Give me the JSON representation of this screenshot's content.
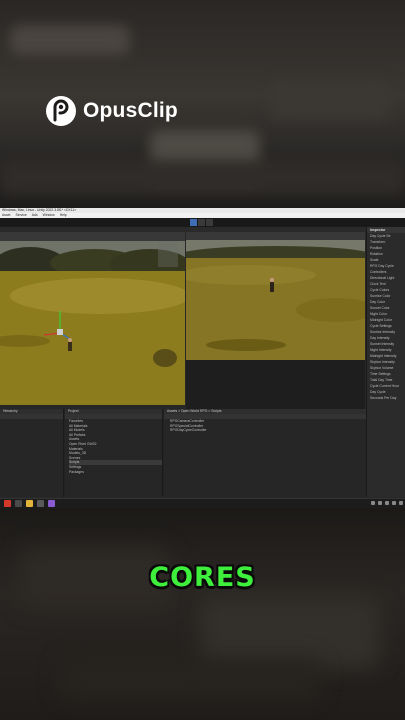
{
  "logo": {
    "text": "OpusClip",
    "icon": "opusclip-logo-icon"
  },
  "caption": {
    "text": "CORES",
    "color": "#3ef03c"
  },
  "editor": {
    "title": "Windows, Mac, Linux - Unity 2022.3.8f1* <DX11>",
    "menu": [
      "Asset",
      "Service",
      "Ads",
      "Window",
      "Help"
    ],
    "play_controls": [
      "play-icon",
      "pause-icon",
      "step-icon"
    ],
    "hierarchy": {
      "tab": "Hierarchy",
      "items": [
        "",
        "",
        "",
        "",
        "",
        ""
      ]
    },
    "project": {
      "tab": "Project",
      "tree": [
        "Favorites",
        "All Materials",
        "All Models",
        "All Prefabs",
        "Assets",
        "Open Rivet GW02",
        "Materials",
        "Models_3D",
        "Scenes",
        "Scripts",
        "Settings",
        "Packages"
      ],
      "selected_index": 9,
      "breadcrumb": "Assets > Open World RPG > Scripts",
      "files": [
        "RPGCameraController",
        "RPGSpecialController",
        "RPGDayCycleController"
      ]
    },
    "inspector": {
      "tab": "Inspector",
      "object_name": "Day Cycle Se",
      "component": "RPG Day Cycle",
      "items": [
        "Transform",
        "Position",
        "Rotation",
        "Scale",
        "RPG Day Cycle",
        "Controllers",
        "Directional Light",
        "Clock Text",
        "Cycle Colors",
        "Sunrise Color",
        "Day Color",
        "Sunset Color",
        "Night Color",
        "Midnight Color",
        "Cycle Settings",
        "Sunrise Intensity",
        "Day Intensity",
        "Sunset Intensity",
        "Night Intensity",
        "Midnight Intensity",
        "Skybox Intensity",
        "Skybox Volume",
        "Time Settings",
        "Total Day Time",
        "Cycle Current Hour",
        "Day Cycle",
        "Seconds Per Day"
      ]
    },
    "taskbar_icons": [
      {
        "name": "chrome-icon",
        "color": "#d33a2c"
      },
      {
        "name": "unity-icon",
        "color": "#4a4a4a"
      },
      {
        "name": "file-explorer-icon",
        "color": "#e2b53a"
      },
      {
        "name": "settings-icon",
        "color": "#5a5a5a"
      },
      {
        "name": "visual-studio-icon",
        "color": "#8a5bd1"
      }
    ]
  }
}
